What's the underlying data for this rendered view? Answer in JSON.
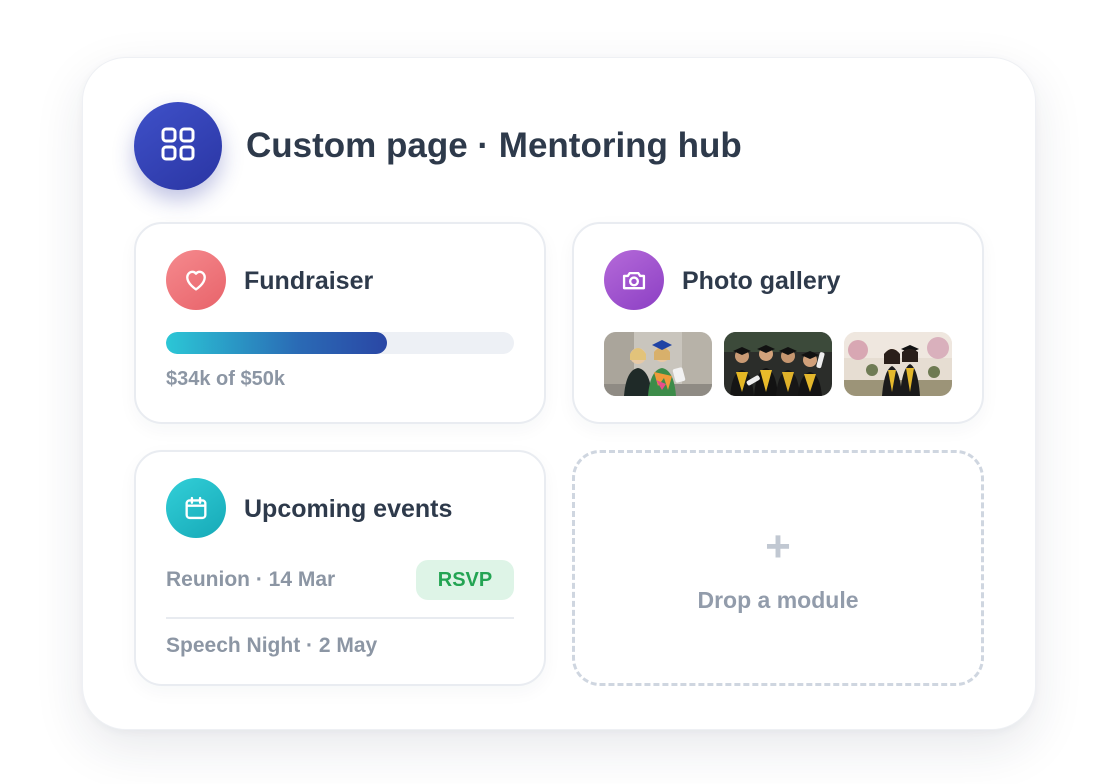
{
  "header": {
    "title": "Custom page · Mentoring hub",
    "icon": "grid-icon",
    "badge_color": "#3344b8"
  },
  "modules": {
    "fundraiser": {
      "title": "Fundraiser",
      "icon": "heart-icon",
      "accent": "#ef7479",
      "progress_fraction": 0.635,
      "progress_label": "$34k of $50k"
    },
    "photo_gallery": {
      "title": "Photo gallery",
      "icon": "camera-icon",
      "accent": "#a152d0",
      "photos": [
        "graduate-photo-1",
        "graduate-photo-2",
        "graduate-photo-3"
      ]
    },
    "events": {
      "title": "Upcoming events",
      "icon": "calendar-icon",
      "accent": "#22bcc7",
      "items": [
        {
          "label": "Reunion · 14 Mar",
          "action": "RSVP"
        },
        {
          "label": "Speech Night · 2 May"
        }
      ],
      "rsvp_color": "#23a453"
    },
    "drop_zone": {
      "symbol": "+",
      "label": "Drop a module"
    }
  }
}
